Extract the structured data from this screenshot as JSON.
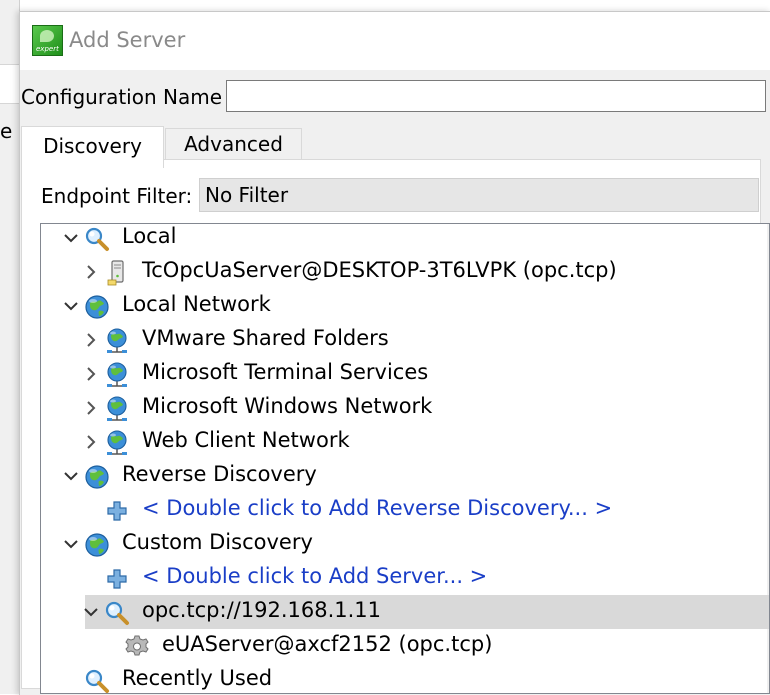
{
  "background": {
    "partial_char": "e"
  },
  "dialog": {
    "title": "Add Server",
    "config_label": "Configuration Name",
    "config_value": "",
    "tabs": [
      {
        "label": "Discovery",
        "active": true
      },
      {
        "label": "Advanced",
        "active": false
      }
    ],
    "filter_label": "Endpoint Filter:",
    "filter_value": "No Filter"
  },
  "tree": {
    "rows": [
      {
        "label": "Local",
        "level": 0,
        "expanded": true,
        "icon": "search-icon"
      },
      {
        "label": "TcOpcUaServer@DESKTOP-3T6LVPK (opc.tcp)",
        "level": 1,
        "expanded": false,
        "icon": "server-icon"
      },
      {
        "label": "Local Network",
        "level": 0,
        "expanded": true,
        "icon": "globe-icon"
      },
      {
        "label": "VMware Shared Folders",
        "level": 1,
        "expanded": false,
        "icon": "network-globe-icon"
      },
      {
        "label": "Microsoft Terminal Services",
        "level": 1,
        "expanded": false,
        "icon": "network-globe-icon"
      },
      {
        "label": "Microsoft Windows Network",
        "level": 1,
        "expanded": false,
        "icon": "network-globe-icon"
      },
      {
        "label": "Web Client Network",
        "level": 1,
        "expanded": false,
        "icon": "network-globe-icon"
      },
      {
        "label": "Reverse Discovery",
        "level": 0,
        "expanded": true,
        "icon": "globe-icon"
      },
      {
        "label": "< Double click to Add Reverse Discovery... >",
        "level": 1,
        "icon": "add-icon",
        "link": true
      },
      {
        "label": "Custom Discovery",
        "level": 0,
        "expanded": true,
        "icon": "globe-icon"
      },
      {
        "label": "< Double click to Add Server... >",
        "level": 1,
        "icon": "add-icon",
        "link": true
      },
      {
        "label": "opc.tcp://192.168.1.11",
        "level": 1,
        "expanded": true,
        "icon": "search-icon",
        "selected": true
      },
      {
        "label": "eUAServer@axcf2152 (opc.tcp)",
        "level": 2,
        "icon": "gear-icon"
      },
      {
        "label": "Recently Used",
        "level": 0,
        "icon": "search-icon"
      }
    ]
  },
  "colors": {
    "link": "#1a3ec7",
    "selection": "#d9d9d9",
    "dialog_bg": "#f0f0f0"
  }
}
